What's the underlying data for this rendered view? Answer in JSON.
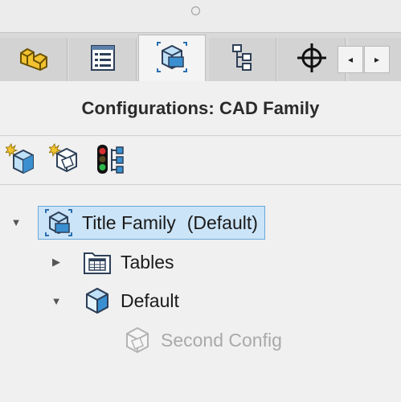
{
  "tabs": [
    {
      "name": "tab-feature-manager",
      "icon": "part-icon",
      "active": false
    },
    {
      "name": "tab-property-manager",
      "icon": "property-sheet-icon",
      "active": false
    },
    {
      "name": "tab-configuration-manager",
      "icon": "configuration-icon",
      "active": true
    },
    {
      "name": "tab-dimxpert-manager",
      "icon": "dimxpert-tree-icon",
      "active": false
    },
    {
      "name": "tab-display-manager",
      "icon": "crosshair-icon",
      "active": false
    }
  ],
  "tab_scroll": {
    "left": "◂",
    "right": "▸"
  },
  "panel": {
    "title": "Configurations: CAD Family"
  },
  "toolbar": {
    "buttons": [
      {
        "name": "add-configuration-button",
        "icon": "new-configuration-icon"
      },
      {
        "name": "add-derived-configuration-button",
        "icon": "derived-configuration-icon"
      },
      {
        "name": "configuration-publisher-button",
        "icon": "traffic-light-tree-icon"
      }
    ]
  },
  "tree": {
    "root": {
      "label": "Title Family",
      "suffix": "(Default)",
      "expanded": true,
      "selected": true
    },
    "tables": {
      "label": "Tables",
      "expanded": false
    },
    "default": {
      "label": "Default",
      "expanded": true
    },
    "second": {
      "label": "Second Config",
      "disabled": true
    }
  },
  "colors": {
    "selection_bg": "#cce4f7",
    "selection_border": "#6aa8d8",
    "accent_blue": "#3a8fd0",
    "part_yellow": "#f2c230"
  }
}
